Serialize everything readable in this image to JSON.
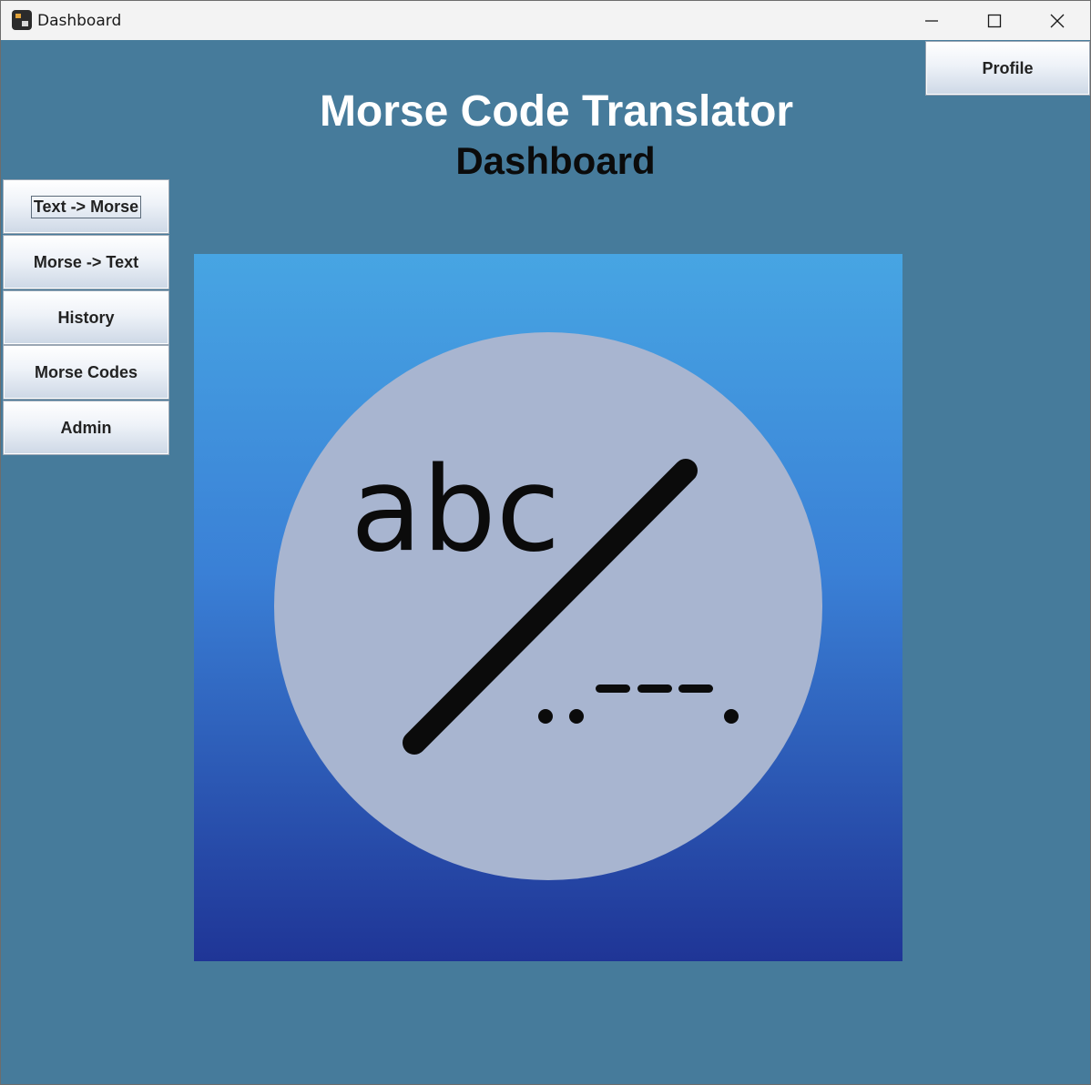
{
  "window": {
    "title": "Dashboard",
    "controls": {
      "minimize": "minimize-icon",
      "maximize": "maximize-icon",
      "close": "close-icon"
    }
  },
  "header": {
    "app_title": "Morse Code Translator",
    "page_title": "Dashboard",
    "profile_label": "Profile"
  },
  "sidebar": {
    "items": [
      {
        "label": "Text -> Morse",
        "focused": true
      },
      {
        "label": "Morse -> Text",
        "focused": false
      },
      {
        "label": "History",
        "focused": false
      },
      {
        "label": "Morse Codes",
        "focused": false
      },
      {
        "label": "Admin",
        "focused": false
      }
    ]
  },
  "logo": {
    "text": "abc",
    "icon": "morse-logo-icon"
  },
  "colors": {
    "background": "#467b9b",
    "logo_gradient_top": "#47a5e3",
    "logo_gradient_bottom": "#1f3596",
    "logo_circle": "#a8b5d0"
  }
}
